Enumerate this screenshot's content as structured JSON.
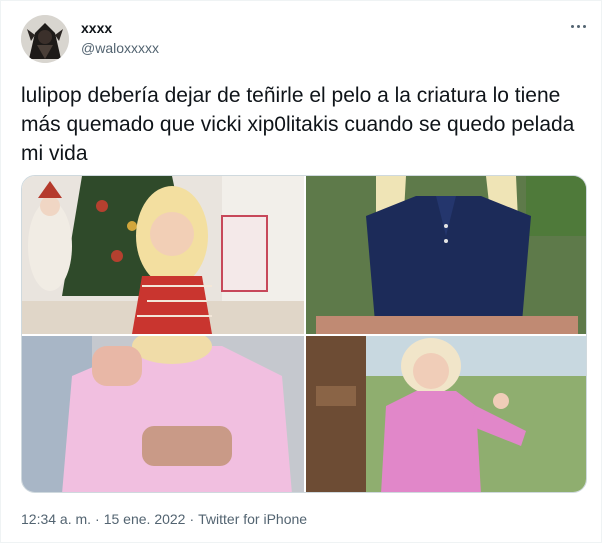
{
  "author": {
    "display_name": "xxxx",
    "handle": "@waloxxxxx"
  },
  "tweet": {
    "text": "lulipop debería dejar de teñirle el pelo a la criatura lo tiene más quemado que vicki xip0litakis cuando se quedo pelada mi vida"
  },
  "media": [
    {
      "label": "photo-1"
    },
    {
      "label": "photo-2"
    },
    {
      "label": "photo-3"
    },
    {
      "label": "photo-4"
    }
  ],
  "meta": {
    "time": "12:34 a. m.",
    "separator1": "·",
    "date": "15 ene. 2022",
    "separator2": "·",
    "source": "Twitter for iPhone"
  },
  "colors": {
    "text_primary": "#0f1419",
    "text_secondary": "#536471",
    "border": "#cfd9de"
  }
}
